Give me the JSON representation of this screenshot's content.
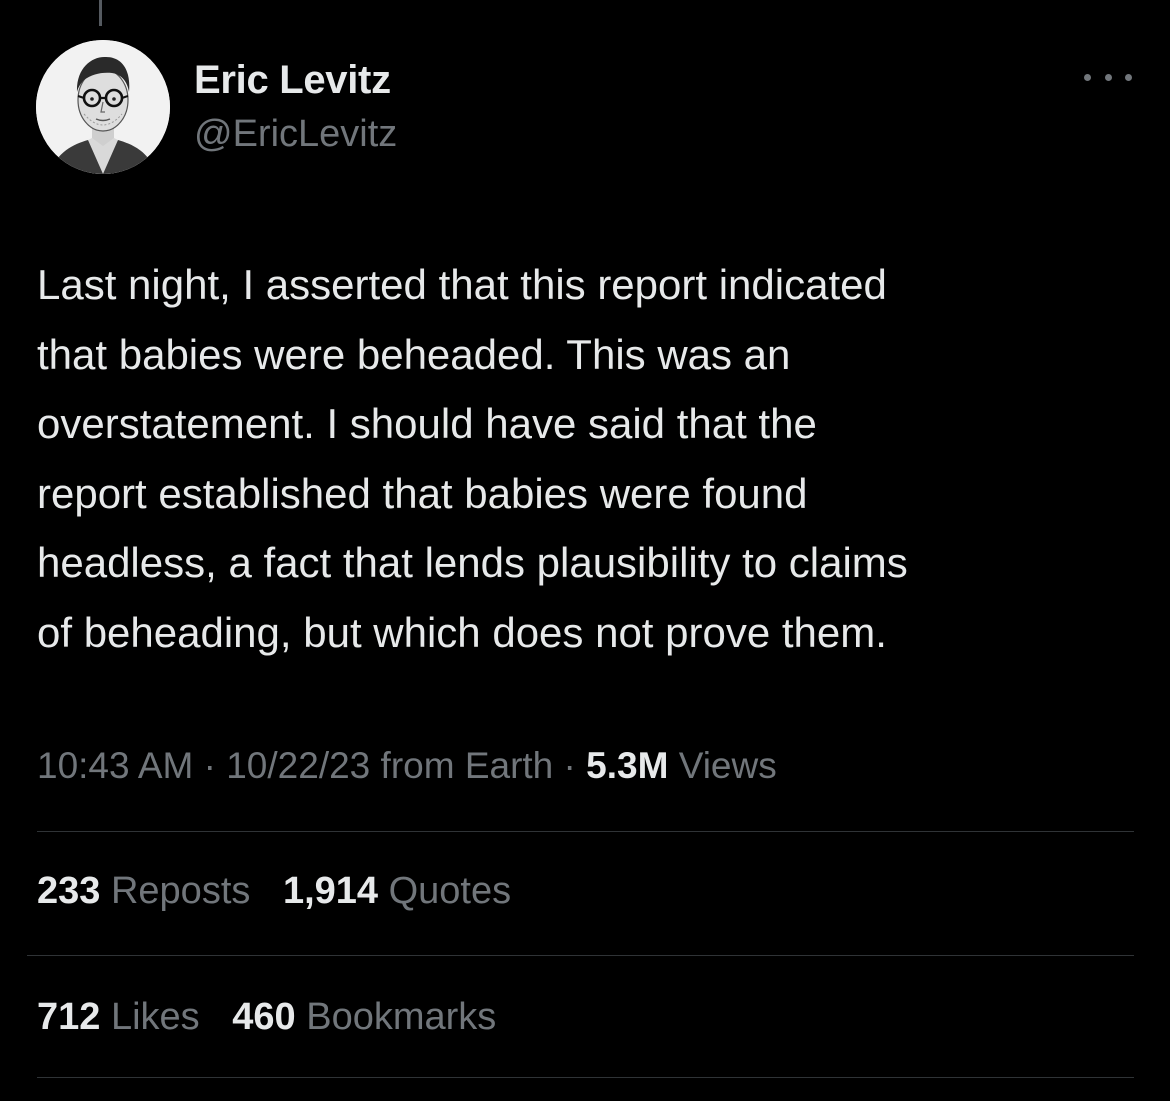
{
  "author": {
    "name": "Eric Levitz",
    "handle": "@EricLevitz"
  },
  "tweet": {
    "lines": [
      "Last night, I asserted that this report indicated",
      "that babies were beheaded. This was an",
      "overstatement. I should have said that the",
      "report established that babies were found",
      "headless, a fact that lends plausibility to claims",
      "of beheading, but which does not prove them."
    ]
  },
  "meta": {
    "time": "10:43 AM",
    "separator": "·",
    "date": "10/22/23",
    "source": "from Earth",
    "views_count": "5.3M",
    "views_label": "Views"
  },
  "stats": {
    "reposts_count": "233",
    "reposts_label": "Reposts",
    "quotes_count": "1,914",
    "quotes_label": "Quotes",
    "likes_count": "712",
    "likes_label": "Likes",
    "bookmarks_count": "460",
    "bookmarks_label": "Bookmarks"
  },
  "icons": {
    "more": "more-horizontal-icon"
  },
  "colors": {
    "background": "#000000",
    "text_primary": "#e7e9ea",
    "text_secondary": "#71767b",
    "divider": "#2f3336"
  }
}
